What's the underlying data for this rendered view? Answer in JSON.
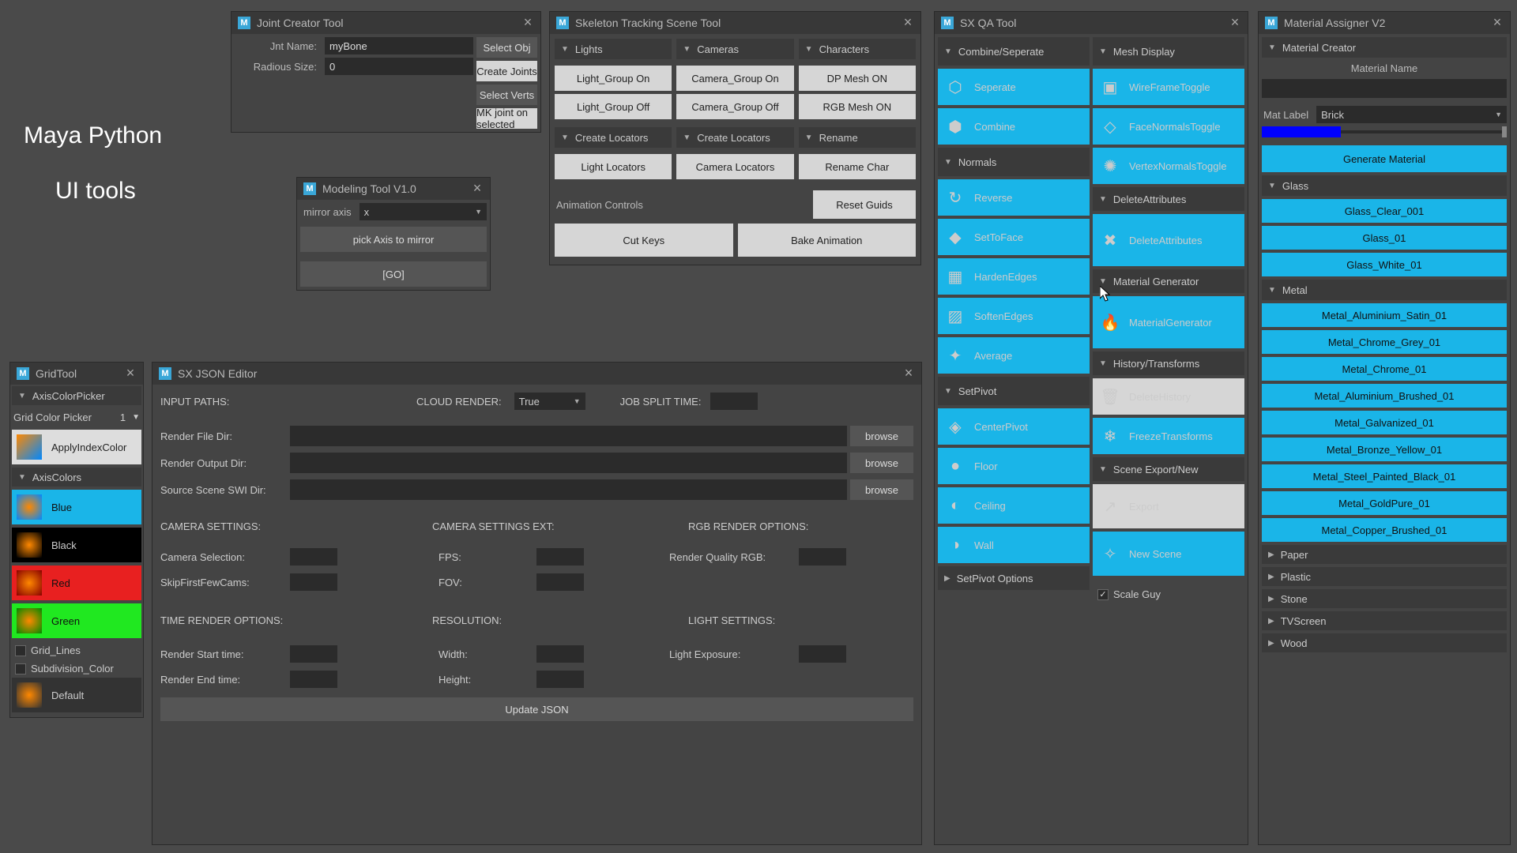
{
  "brand_title1": "Maya Python",
  "brand_title2": "UI tools",
  "jointCreator": {
    "title": "Joint Creator Tool",
    "jntName_lbl": "Jnt Name:",
    "jntName_val": "myBone",
    "radious_lbl": "Radious Size:",
    "radious_val": "0",
    "selectObj": "Select Obj",
    "createJoints": "Create Joints",
    "selectVerts": "Select Verts",
    "mkJoint": "MK joint on selected"
  },
  "modeling": {
    "title": "Modeling Tool V1.0",
    "mirror_lbl": "mirror axis",
    "mirror_val": "x",
    "pickAxis": "pick Axis to mirror",
    "go": "[GO]"
  },
  "skeleton": {
    "title": "Skeleton Tracking Scene Tool",
    "lights": "Lights",
    "cameras": "Cameras",
    "characters": "Characters",
    "lgOn": "Light_Group On",
    "lgOff": "Light_Group Off",
    "cgOn": "Camera_Group On",
    "cgOff": "Camera_Group Off",
    "dpOn": "DP Mesh ON",
    "rgbOn": "RGB Mesh ON",
    "createLoc": "Create Locators",
    "createLoc2": "Create Locators",
    "rename": "Rename",
    "lightLoc": "Light Locators",
    "camLoc": "Camera Locators",
    "renameChar": "Rename Char",
    "animCtrl": "Animation Controls",
    "resetGuids": "Reset Guids",
    "cutKeys": "Cut Keys",
    "bakeAnim": "Bake Animation"
  },
  "sxqa": {
    "title": "SX QA Tool",
    "combineSep": "Combine/Seperate",
    "seperate": "Seperate",
    "combine": "Combine",
    "normals": "Normals",
    "reverse": "Reverse",
    "setToFace": "SetToFace",
    "hardenEdges": "HardenEdges",
    "softenEdges": "SoftenEdges",
    "average": "Average",
    "setPivot": "SetPivot",
    "centerPivot": "CenterPivot",
    "floor": "Floor",
    "ceiling": "Ceiling",
    "wall": "Wall",
    "setPivotOpt": "SetPivot Options",
    "meshDisplay": "Mesh Display",
    "wireframe": "WireFrameToggle",
    "faceNormals": "FaceNormalsToggle",
    "vertexNormals": "VertexNormalsToggle",
    "deleteAttr": "DeleteAttributes",
    "deleteAttrBtn": "DeleteAttributes",
    "matGen": "Material Generator",
    "matGenBtn": "MaterialGenerator",
    "histTrans": "History/Transforms",
    "delHist": "DeleteHistory",
    "freeze": "FreezeTransforms",
    "sceneExport": "Scene Export/New",
    "export": "Export",
    "newScene": "New Scene",
    "scaleGuy": "Scale Guy"
  },
  "matAssigner": {
    "title": "Material Assigner V2",
    "matCreator": "Material Creator",
    "matName": "Material Name",
    "matLabel_lbl": "Mat Label",
    "matLabel_val": "Brick",
    "genMat": "Generate Material",
    "glass": "Glass",
    "glass_items": [
      "Glass_Clear_001",
      "Glass_01",
      "Glass_White_01"
    ],
    "metal": "Metal",
    "metal_items": [
      "Metal_Aluminium_Satin_01",
      "Metal_Chrome_Grey_01",
      "Metal_Chrome_01",
      "Metal_Aluminium_Brushed_01",
      "Metal_Galvanized_01",
      "Metal_Bronze_Yellow_01",
      "Metal_Steel_Painted_Black_01",
      "Metal_GoldPure_01",
      "Metal_Copper_Brushed_01"
    ],
    "paper": "Paper",
    "plastic": "Plastic",
    "stone": "Stone",
    "tvscreen": "TVScreen",
    "wood": "Wood"
  },
  "gridTool": {
    "title": "GridTool",
    "axisPicker": "AxisColorPicker",
    "gridColorPicker": "Grid Color Picker",
    "gridColorVal": "1",
    "applyIndex": "ApplyIndexColor",
    "axisColors": "AxisColors",
    "blue": "Blue",
    "black": "Black",
    "red": "Red",
    "green": "Green",
    "gridLines": "Grid_Lines",
    "subdiv": "Subdivision_Color",
    "default": "Default"
  },
  "sxjson": {
    "title": "SX JSON Editor",
    "inputPaths": "INPUT PATHS:",
    "cloudRender": "CLOUD RENDER:",
    "cloudVal": "True",
    "jobSplit": "JOB SPLIT TIME:",
    "renderFile": "Render File Dir:",
    "renderOutput": "Render Output Dir:",
    "sourceScene": "Source Scene SWI Dir:",
    "browse": "browse",
    "camSettings": "CAMERA SETTINGS:",
    "camSettingsExt": "CAMERA SETTINGS EXT:",
    "rgbOpts": "RGB RENDER OPTIONS:",
    "camSel": "Camera Selection:",
    "fps": "FPS:",
    "renderQual": "Render Quality RGB:",
    "skipFirst": "SkipFirstFewCams:",
    "fov": "FOV:",
    "timeOpts": "TIME RENDER OPTIONS:",
    "resolution": "RESOLUTION:",
    "lightSet": "LIGHT SETTINGS:",
    "renderStart": "Render Start time:",
    "width": "Width:",
    "lightExp": "Light Exposure:",
    "renderEnd": "Render End time:",
    "height": "Height:",
    "updateJson": "Update JSON"
  }
}
